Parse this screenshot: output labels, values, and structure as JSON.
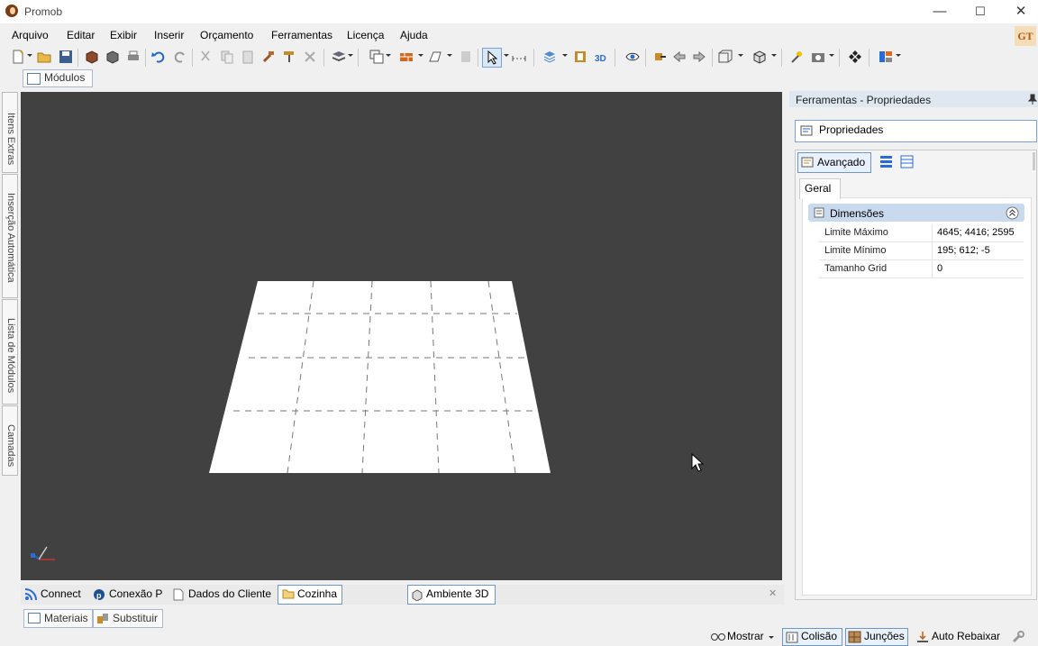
{
  "window": {
    "title": "Promob",
    "minimize": "—",
    "maximize": "☐",
    "close": "✕"
  },
  "menu": [
    "Arquivo",
    "Editar",
    "Exibir",
    "Inserir",
    "Orçamento",
    "Ferramentas",
    "Licença",
    "Ajuda"
  ],
  "user_badge": "GT",
  "modules_tab": "Módulos",
  "left_tabs": [
    "Itens Extras",
    "Inserção Automática",
    "Lista de Módulos",
    "Camadas"
  ],
  "doc_tabs": {
    "connect": "Connect",
    "conexao": "Conexão P",
    "dados": "Dados do Cliente",
    "cozinha": "Cozinha",
    "ambiente": "Ambiente 3D",
    "close": "✕"
  },
  "bottom_tabs": {
    "materiais": "Materiais",
    "substituir": "Substituir"
  },
  "panel": {
    "title": "Ferramentas - Propriedades",
    "pin": "📌",
    "prop_button": "Propriedades",
    "advanced": "Avançado",
    "tab": "Geral",
    "group": "Dimensões",
    "properties": [
      {
        "name": "Limite Máximo",
        "value": "4645; 4416; 2595"
      },
      {
        "name": "Limite Mínimo",
        "value": "195; 612; -5"
      },
      {
        "name": "Tamanho Grid",
        "value": "0"
      }
    ]
  },
  "status": {
    "mostrar": "Mostrar",
    "colisao": "Colisão",
    "juncoes": "Junções",
    "auto": "Auto Rebaixar"
  },
  "colors": {
    "viewport": "#414141",
    "floor": "#ffffff",
    "accent": "#2a6bd6"
  }
}
